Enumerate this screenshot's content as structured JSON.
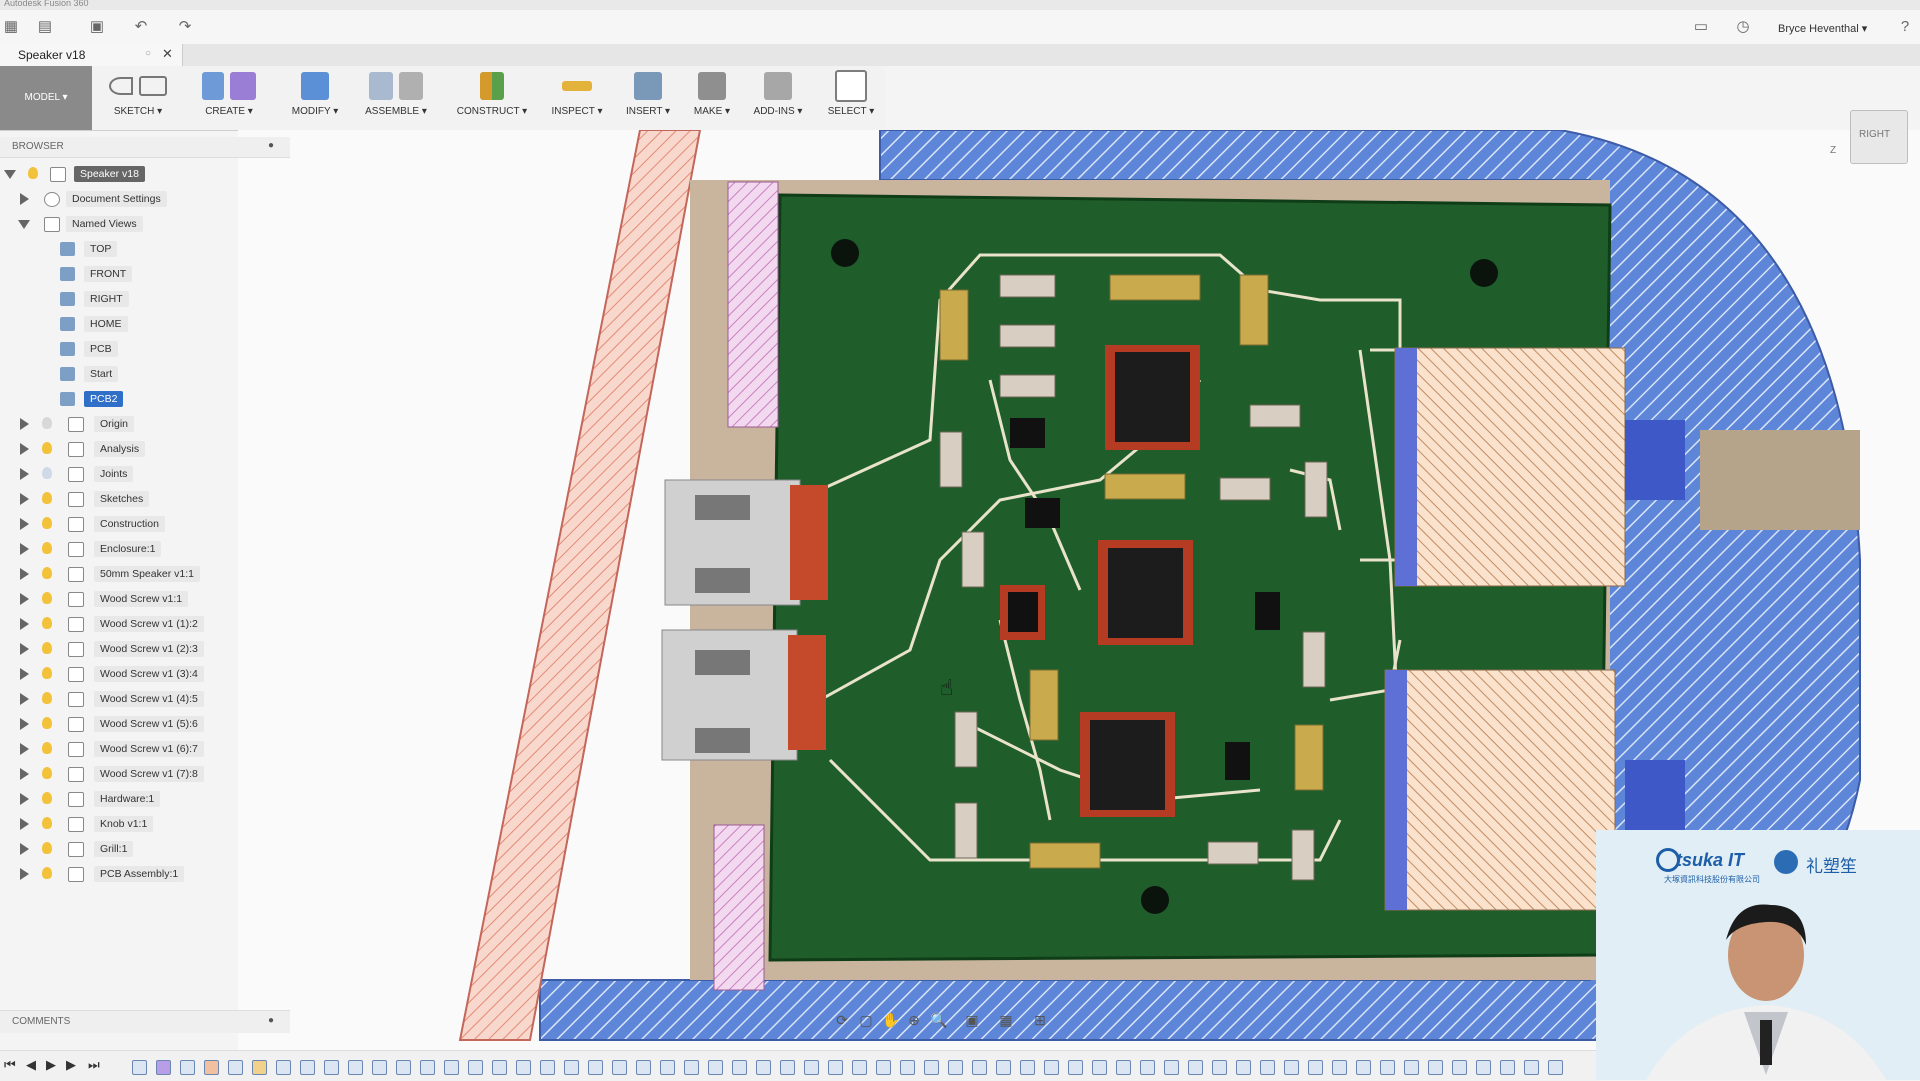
{
  "app": {
    "title": "Autodesk Fusion 360",
    "user": "Bryce Heventhal ▾"
  },
  "tab": {
    "label": "Speaker v18",
    "close": "✕"
  },
  "toolbar": {
    "workspace": "MODEL ▾",
    "groups": [
      {
        "label": "SKETCH ▾"
      },
      {
        "label": "CREATE ▾"
      },
      {
        "label": "MODIFY ▾"
      },
      {
        "label": "ASSEMBLE ▾"
      },
      {
        "label": "CONSTRUCT ▾"
      },
      {
        "label": "INSPECT ▾"
      },
      {
        "label": "INSERT ▾"
      },
      {
        "label": "MAKE ▾"
      },
      {
        "label": "ADD-INS ▾"
      },
      {
        "label": "SELECT ▾"
      }
    ]
  },
  "browser": {
    "title": "BROWSER",
    "root": "Speaker v18",
    "doc_settings": "Document Settings",
    "named_views": "Named Views",
    "views": [
      "TOP",
      "FRONT",
      "RIGHT",
      "HOME",
      "PCB",
      "Start",
      "PCB2"
    ],
    "items": [
      "Origin",
      "Analysis",
      "Joints",
      "Sketches",
      "Construction",
      "Enclosure:1",
      "50mm Speaker v1:1",
      "Wood Screw v1:1",
      "Wood Screw v1 (1):2",
      "Wood Screw v1 (2):3",
      "Wood Screw v1 (3):4",
      "Wood Screw v1 (4):5",
      "Wood Screw v1 (5):6",
      "Wood Screw v1 (6):7",
      "Wood Screw v1 (7):8",
      "Hardware:1",
      "Knob v1:1",
      "Grill:1",
      "PCB Assembly:1"
    ]
  },
  "comments": {
    "title": "COMMENTS"
  },
  "viewcube": {
    "label": "RIGHT",
    "axis": "Z"
  },
  "webcam": {
    "logo": "tsuka IT",
    "company": "大塚資訊科技股份有限公司",
    "brand2": "礼塑笙"
  },
  "colors": {
    "pcb_green": "#1f5d2a",
    "hatch_blue": "#5e86d8",
    "hatch_pink": "#f2b7ad",
    "copper": "#b5562d"
  }
}
